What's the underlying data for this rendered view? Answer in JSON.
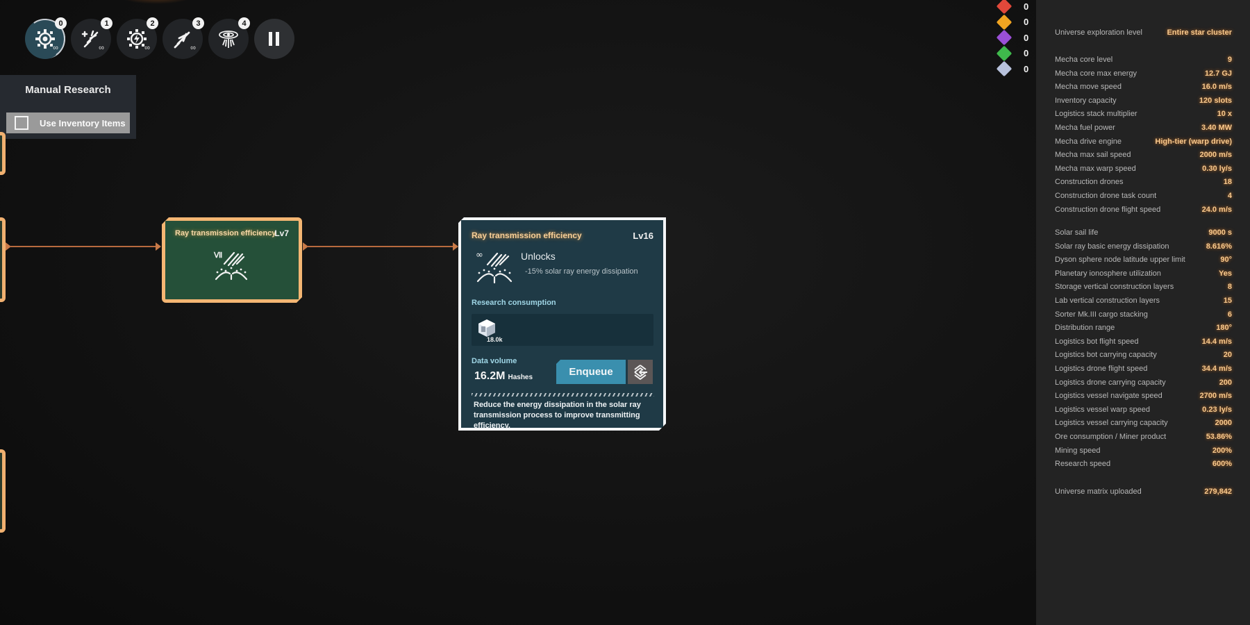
{
  "toolbar": {
    "buttons": [
      {
        "badge": "0",
        "icon": "mecha-core-gear-icon",
        "infinite": "∞",
        "active": true
      },
      {
        "badge": "1",
        "icon": "drone-upgrade-icon",
        "infinite": "∞",
        "active": false
      },
      {
        "badge": "2",
        "icon": "energy-gear-icon",
        "infinite": "∞",
        "active": false
      },
      {
        "badge": "3",
        "icon": "vessel-icon",
        "infinite": "∞",
        "active": false
      },
      {
        "badge": "4",
        "icon": "galaxy-icon",
        "infinite": "",
        "active": false
      }
    ],
    "pause_icon": "pause-icon"
  },
  "manual_research": {
    "title": "Manual Research",
    "use_inventory_label": "Use Inventory Items",
    "use_inventory_checked": false
  },
  "tech_node": {
    "title": "Ray transmission efficiency",
    "level": "Lv7",
    "tier": "Ⅶ"
  },
  "detail_card": {
    "title": "Ray transmission efficiency",
    "level": "Lv16",
    "tier": "∞",
    "unlocks_label": "Unlocks",
    "effect": "-15% solar ray energy dissipation",
    "consumption_label": "Research consumption",
    "items": [
      {
        "name": "universe-matrix",
        "count": "18.0k"
      }
    ],
    "data_volume_label": "Data volume",
    "data_volume_value": "16.2M",
    "data_volume_unit": "Hashes",
    "enqueue_label": "Enqueue",
    "description": "Reduce the energy dissipation in the solar ray transmission process to improve transmitting efficiency."
  },
  "resources": [
    {
      "name": "electromagnetic-matrix",
      "color": "#e0483a",
      "count": "0"
    },
    {
      "name": "energy-matrix",
      "color": "#f0a421",
      "count": "0"
    },
    {
      "name": "structure-matrix",
      "color": "#9a4fd6",
      "count": "0"
    },
    {
      "name": "information-matrix",
      "color": "#3fb94c",
      "count": "0"
    },
    {
      "name": "gravity-matrix",
      "color": "#b8c2dc",
      "count": "0"
    }
  ],
  "stats": [
    {
      "label": "Universe exploration level",
      "value": "Entire star cluster"
    },
    {
      "label": "Mecha core level",
      "value": "9"
    },
    {
      "label": "Mecha core max energy",
      "value": "12.7 GJ"
    },
    {
      "label": "Mecha move speed",
      "value": "16.0 m/s"
    },
    {
      "label": "Inventory capacity",
      "value": "120 slots"
    },
    {
      "label": "Logistics stack multiplier",
      "value": "10 x"
    },
    {
      "label": "Mecha fuel power",
      "value": "3.40 MW"
    },
    {
      "label": "Mecha drive engine",
      "value": "High-tier (warp drive)"
    },
    {
      "label": "Mecha max sail speed",
      "value": "2000 m/s"
    },
    {
      "label": "Mecha max warp speed",
      "value": "0.30 ly/s"
    },
    {
      "label": "Construction drones",
      "value": "18"
    },
    {
      "label": "Construction drone task count",
      "value": "4"
    },
    {
      "label": "Construction drone flight speed",
      "value": "24.0 m/s"
    },
    {
      "label": "Solar sail life",
      "value": "9000 s"
    },
    {
      "label": "Solar ray basic energy dissipation",
      "value": "8.616%"
    },
    {
      "label": "Dyson sphere node latitude upper limit",
      "value": "90°"
    },
    {
      "label": "Planetary ionosphere utilization",
      "value": "Yes"
    },
    {
      "label": "Storage vertical construction layers",
      "value": "8"
    },
    {
      "label": "Lab vertical construction layers",
      "value": "15"
    },
    {
      "label": "Sorter Mk.III cargo stacking",
      "value": "6"
    },
    {
      "label": "Distribution range",
      "value": "180°"
    },
    {
      "label": "Logistics bot flight speed",
      "value": "14.4 m/s"
    },
    {
      "label": "Logistics bot carrying capacity",
      "value": "20"
    },
    {
      "label": "Logistics drone flight speed",
      "value": "34.4 m/s"
    },
    {
      "label": "Logistics drone carrying capacity",
      "value": "200"
    },
    {
      "label": "Logistics vessel navigate speed",
      "value": "2700 m/s"
    },
    {
      "label": "Logistics vessel warp speed",
      "value": "0.23 ly/s"
    },
    {
      "label": "Logistics vessel carrying capacity",
      "value": "2000"
    },
    {
      "label": "Ore consumption / Miner product",
      "value": "53.86%"
    },
    {
      "label": "Mining speed",
      "value": "200%"
    },
    {
      "label": "Research speed",
      "value": "600%"
    },
    {
      "label": "Universe matrix uploaded",
      "value": "279,842"
    }
  ]
}
